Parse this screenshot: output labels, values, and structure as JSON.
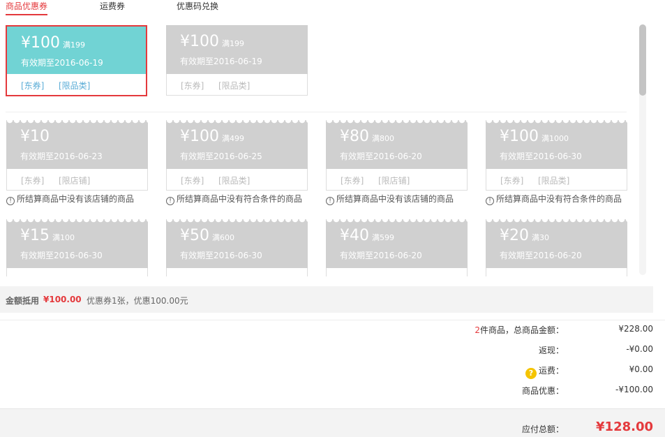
{
  "tabs": [
    {
      "label": "商品优惠券",
      "active": true
    },
    {
      "label": "运费券",
      "active": false
    },
    {
      "label": "优惠码兑换",
      "active": false
    }
  ],
  "usable_coupons": [
    {
      "amount": "¥100",
      "condition": "满199",
      "validity": "有效期至2016-06-19",
      "tags": [
        "[东券]",
        "[限品类]"
      ],
      "selected": true
    },
    {
      "amount": "¥100",
      "condition": "满199",
      "validity": "有效期至2016-06-19",
      "tags": [
        "[东券]",
        "[限品类]"
      ],
      "selected": false
    }
  ],
  "unusable_coupons": [
    {
      "amount": "¥10",
      "condition": "",
      "validity": "有效期至2016-06-23",
      "tags": [
        "[东券]",
        "[限店铺]"
      ],
      "note": "所结算商品中没有该店铺的商品"
    },
    {
      "amount": "¥100",
      "condition": "满499",
      "validity": "有效期至2016-06-25",
      "tags": [
        "[东券]",
        "[限品类]"
      ],
      "note": "所结算商品中没有符合条件的商品"
    },
    {
      "amount": "¥80",
      "condition": "满800",
      "validity": "有效期至2016-06-20",
      "tags": [
        "[东券]",
        "[限店铺]"
      ],
      "note": "所结算商品中没有该店铺的商品"
    },
    {
      "amount": "¥100",
      "condition": "满1000",
      "validity": "有效期至2016-06-30",
      "tags": [
        "[东券]",
        "[限品类]"
      ],
      "note": "所结算商品中没有符合条件的商品"
    },
    {
      "amount": "¥15",
      "condition": "满100",
      "validity": "有效期至2016-06-30",
      "tags": [
        "",
        ""
      ],
      "note": ""
    },
    {
      "amount": "¥50",
      "condition": "满600",
      "validity": "有效期至2016-06-30",
      "tags": [
        "",
        ""
      ],
      "note": ""
    },
    {
      "amount": "¥40",
      "condition": "满599",
      "validity": "有效期至2016-06-20",
      "tags": [
        "",
        ""
      ],
      "note": ""
    },
    {
      "amount": "¥20",
      "condition": "满30",
      "validity": "有效期至2016-06-20",
      "tags": [
        "",
        ""
      ],
      "note": ""
    }
  ],
  "summary": {
    "label": "金额抵用",
    "amount": "¥100.00",
    "detail": "优惠券1张，优惠100.00元"
  },
  "totals": {
    "item_count": "2",
    "item_label": "件商品，总商品金额：",
    "item_value": "¥228.00",
    "cashback_label": "返现：",
    "cashback_value": "-¥0.00",
    "shipping_label": "运费：",
    "shipping_value": "¥0.00",
    "discount_label": "商品优惠：",
    "discount_value": "-¥100.00",
    "payable_label": "应付总额：",
    "payable_value": "¥128.00"
  },
  "scroll": {
    "position_fraction": 0.0
  }
}
